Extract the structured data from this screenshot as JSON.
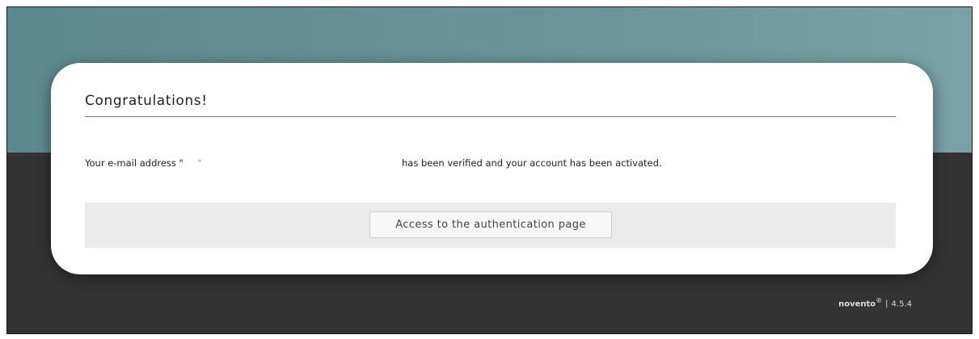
{
  "card": {
    "title": "Congratulations!",
    "message_prefix": "Your e-mail address \"",
    "message_redacted": "\"",
    "message_suffix": "has been verified and your account has been activated.",
    "button_label": "Access to the authentication page"
  },
  "footer": {
    "brand": "novento",
    "trademark": "®",
    "separator": "|",
    "version": "4.5.4"
  },
  "colors": {
    "top_band": "#6b9499",
    "bottom_band": "#333333",
    "card_bg": "#ffffff",
    "action_bar": "#ebebeb"
  }
}
